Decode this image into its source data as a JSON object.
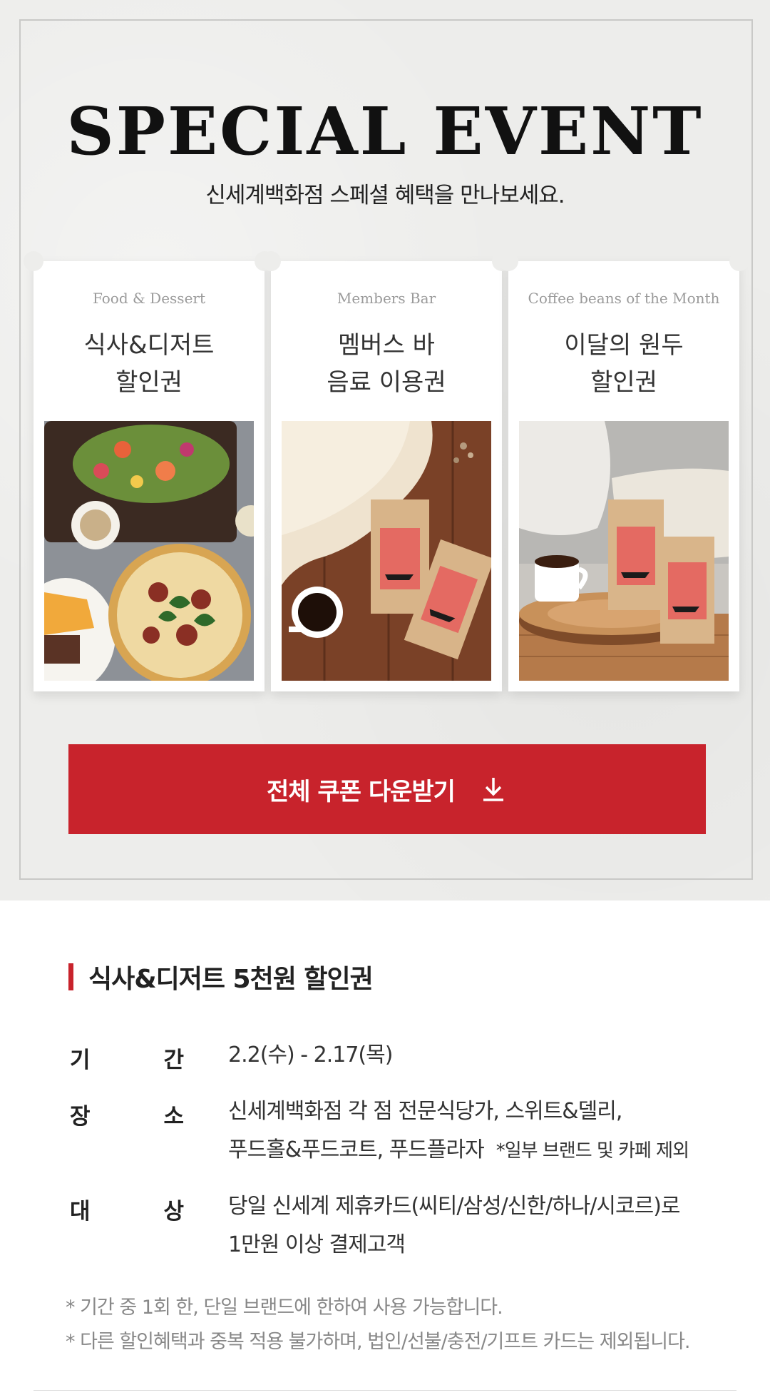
{
  "event": {
    "title": "SPECIAL EVENT",
    "subtitle": "신세계백화점 스페셜 혜택을 만나보세요."
  },
  "cards": [
    {
      "eng": "Food & Dessert",
      "kor_line1": "식사&디저트",
      "kor_line2": "할인권",
      "image": "food-platter-photo"
    },
    {
      "eng": "Members Bar",
      "kor_line1": "멤버스 바",
      "kor_line2": "음료 이용권",
      "image": "coffee-bag-fur-photo"
    },
    {
      "eng": "Coffee beans of the Month",
      "kor_line1": "이달의 원두",
      "kor_line2": "할인권",
      "image": "coffee-bags-wood-photo"
    }
  ],
  "download": {
    "label": "전체 쿠폰 다운받기",
    "icon": "download-icon"
  },
  "detail": {
    "title": "식사&디저트 5천원 할인권",
    "rows": [
      {
        "label_a": "기",
        "label_b": "간",
        "line1": "2.2(수) - 2.17(목)",
        "line2": "",
        "note": ""
      },
      {
        "label_a": "장",
        "label_b": "소",
        "line1": "신세계백화점 각 점 전문식당가, 스위트&델리,",
        "line2": "푸드홀&푸드코트, 푸드플라자",
        "note": "*일부 브랜드 및 카페 제외"
      },
      {
        "label_a": "대",
        "label_b": "상",
        "line1": "당일 신세계 제휴카드(씨티/삼성/신한/하나/시코르)로",
        "line2": "1만원 이상 결제고객",
        "note": ""
      }
    ],
    "notes": [
      "* 기간 중 1회 한, 단일 브랜드에 한하여 사용 가능합니다.",
      "* 다른 할인혜택과 중복 적용 불가하며, 법인/선불/충전/기프트 카드는 제외됩니다."
    ]
  },
  "colors": {
    "accent": "#c8232c",
    "panel_bg": "#ededeb"
  }
}
